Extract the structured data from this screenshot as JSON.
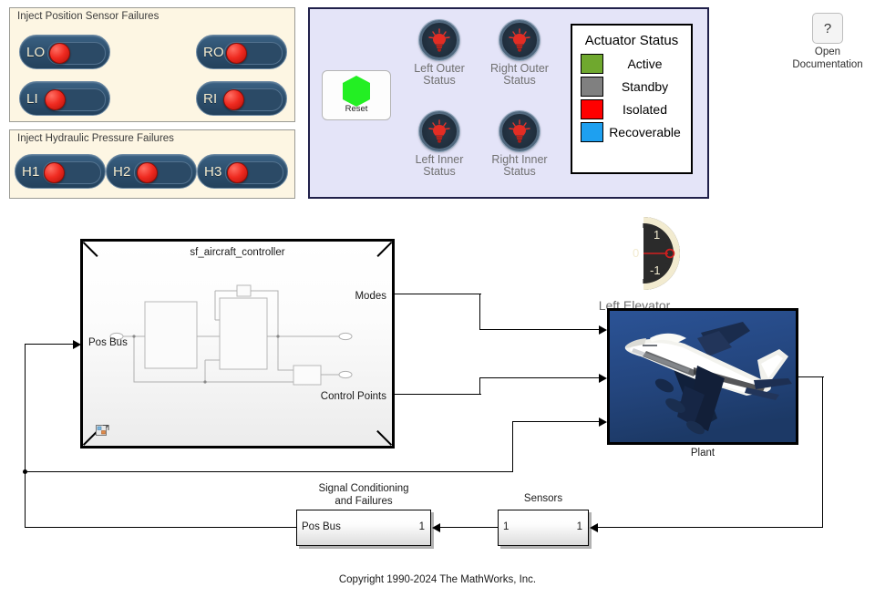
{
  "panels": {
    "position_sensor": {
      "title": "Inject Position Sensor Failures",
      "switches": [
        {
          "label": "LO",
          "name": "toggle-lo"
        },
        {
          "label": "RO",
          "name": "toggle-ro"
        },
        {
          "label": "LI",
          "name": "toggle-li"
        },
        {
          "label": "RI",
          "name": "toggle-ri"
        }
      ]
    },
    "hydraulic": {
      "title": "Inject Hydraulic Pressure Failures",
      "switches": [
        {
          "label": "H1",
          "name": "toggle-h1"
        },
        {
          "label": "H2",
          "name": "toggle-h2"
        },
        {
          "label": "H3",
          "name": "toggle-h3"
        }
      ]
    },
    "status": {
      "reset_label": "Reset",
      "lamps": [
        {
          "caption_line1": "Left Outer",
          "caption_line2": "Status"
        },
        {
          "caption_line1": "Right Outer",
          "caption_line2": "Status"
        },
        {
          "caption_line1": "Left Inner",
          "caption_line2": "Status"
        },
        {
          "caption_line1": "Right Inner",
          "caption_line2": "Status"
        }
      ],
      "legend": {
        "title": "Actuator Status",
        "items": [
          {
            "label": "Active",
            "color": "#6fa82e"
          },
          {
            "label": "Standby",
            "color": "#808080"
          },
          {
            "label": "Isolated",
            "color": "#ff0000"
          },
          {
            "label": "Recoverable",
            "color": "#1ea0f0"
          }
        ]
      }
    }
  },
  "documentation": {
    "icon_label": "?",
    "caption_line1": "Open",
    "caption_line2": "Documentation"
  },
  "diagram": {
    "controller": {
      "title": "sf_aircraft_controller",
      "input_port": "Pos Bus",
      "output_ports": [
        "Modes",
        "Control Points"
      ]
    },
    "gauge": {
      "caption": "Left Elevator",
      "tick_top": "1",
      "tick_mid": "0",
      "tick_bottom": "-1",
      "value": 0,
      "min": -1,
      "max": 1
    },
    "plant": {
      "label": "Plant"
    },
    "signal_conditioning": {
      "label_line1": "Signal Conditioning",
      "label_line2": "and Failures",
      "input_label": "Pos Bus",
      "output_label": "1"
    },
    "sensors": {
      "label": "Sensors",
      "input_label": "1",
      "output_label": "1"
    }
  },
  "footer": {
    "copyright": "Copyright 1990-2024 The MathWorks, Inc."
  }
}
